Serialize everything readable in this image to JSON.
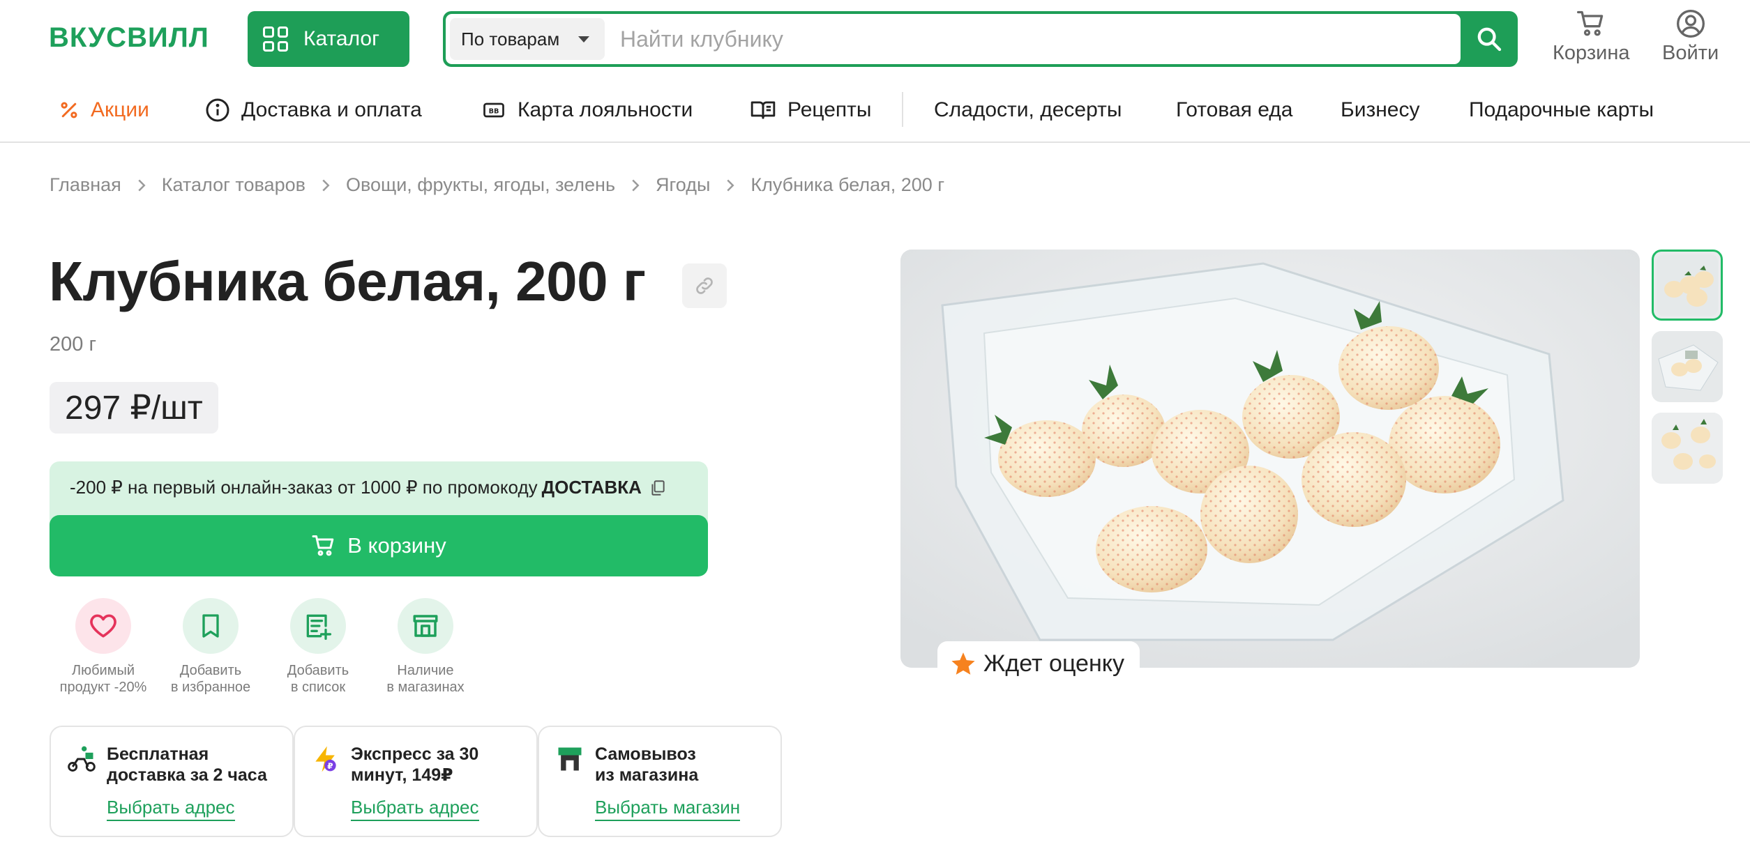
{
  "brand": {
    "logo": "ВКУСВИЛЛ",
    "accent": "#1e9e57",
    "accent_light": "#22bb67",
    "promo_color": "#f26a20"
  },
  "header": {
    "catalog_label": "Каталог",
    "search_type": "По товарам",
    "search_placeholder": "Найти клубнику",
    "cart_label": "Корзина",
    "login_label": "Войти"
  },
  "nav": {
    "items": [
      {
        "label": "Акции",
        "icon": "percent-icon"
      },
      {
        "label": "Доставка и оплата",
        "icon": "info-icon"
      },
      {
        "label": "Карта лояльности",
        "icon": "card-icon"
      },
      {
        "label": "Рецепты",
        "icon": "book-icon"
      },
      {
        "label": "Сладости, десерты"
      },
      {
        "label": "Готовая еда"
      },
      {
        "label": "Бизнесу"
      },
      {
        "label": "Подарочные карты"
      }
    ]
  },
  "breadcrumbs": [
    "Главная",
    "Каталог товаров",
    "Овощи, фрукты, ягоды, зелень",
    "Ягоды",
    "Клубника белая, 200 г"
  ],
  "product": {
    "title": "Клубника белая, 200 г",
    "weight": "200 г",
    "price": "297 ₽/шт",
    "promo_text": "-200 ₽ на первый онлайн-заказ от 1000 ₽ по промокоду",
    "promo_code": "ДОСТАВКА",
    "cart_button": "В корзину",
    "rating_label": "Ждет оценку"
  },
  "actions": [
    {
      "line1": "Любимый",
      "line2": "продукт -20%",
      "icon": "heart-icon"
    },
    {
      "line1": "Добавить",
      "line2": "в избранное",
      "icon": "bookmark-icon"
    },
    {
      "line1": "Добавить",
      "line2": "в список",
      "icon": "list-add-icon"
    },
    {
      "line1": "Наличие",
      "line2": "в магазинах",
      "icon": "store-icon"
    }
  ],
  "delivery": [
    {
      "title_line1": "Бесплатная",
      "title_line2": "доставка за 2 часа",
      "link": "Выбрать адрес",
      "icon": "courier-icon"
    },
    {
      "title_line1": "Экспресс за 30",
      "title_line2": "минут, 149₽",
      "link": "Выбрать адрес",
      "icon": "lightning-icon"
    },
    {
      "title_line1": "Самовывоз",
      "title_line2": "из магазина",
      "link": "Выбрать магазин",
      "icon": "shop-icon"
    }
  ]
}
